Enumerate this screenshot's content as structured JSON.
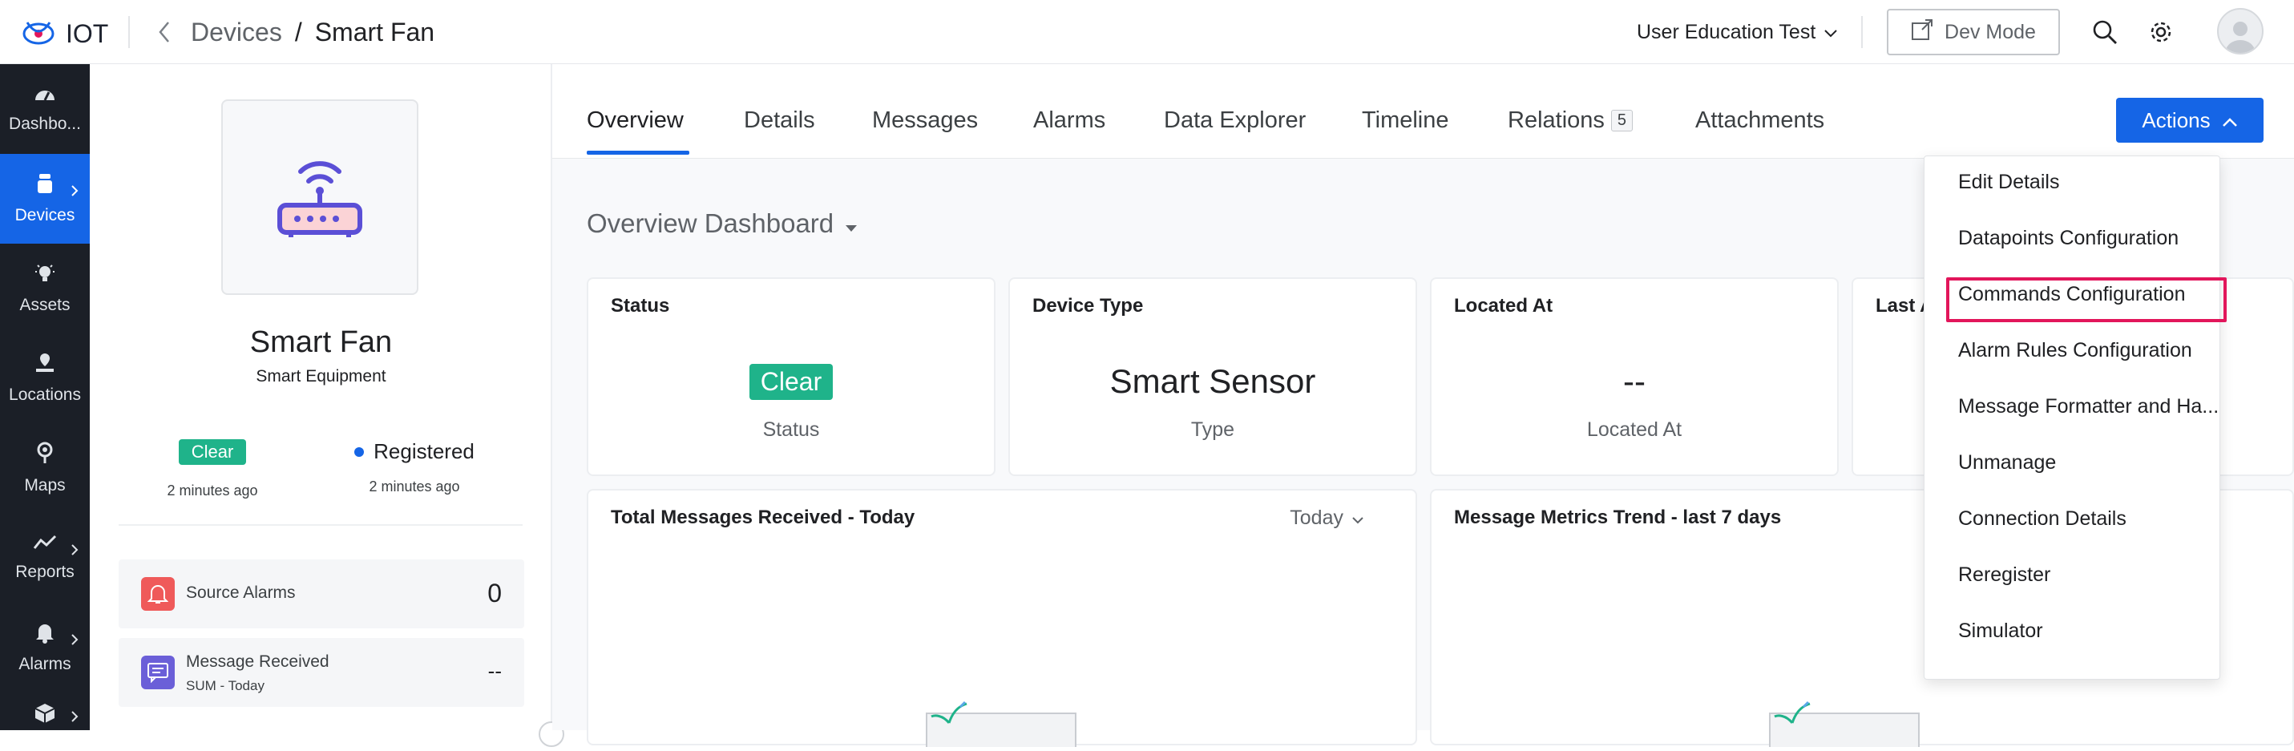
{
  "app": {
    "name": "IOT"
  },
  "breadcrumb": {
    "parent": "Devices",
    "separator": "/",
    "current": "Smart Fan"
  },
  "header": {
    "account": "User Education Test",
    "dev_mode_label": "Dev Mode"
  },
  "icons": {
    "logo": "iot-logo-icon",
    "back": "chevron-left-icon",
    "account_dd": "chevron-down-icon",
    "dev_mode": "external-link-icon",
    "search": "search-icon",
    "settings": "gear-icon",
    "avatar": "user-avatar-icon"
  },
  "sidebar": {
    "items": [
      {
        "label": "Dashbo...",
        "icon": "dashboard-icon",
        "active": false,
        "has_submenu": false
      },
      {
        "label": "Devices",
        "icon": "device-icon",
        "active": true,
        "has_submenu": true
      },
      {
        "label": "Assets",
        "icon": "bulb-icon",
        "active": false,
        "has_submenu": false
      },
      {
        "label": "Locations",
        "icon": "location-icon",
        "active": false,
        "has_submenu": false
      },
      {
        "label": "Maps",
        "icon": "map-pin-icon",
        "active": false,
        "has_submenu": false
      },
      {
        "label": "Reports",
        "icon": "trend-icon",
        "active": false,
        "has_submenu": true
      },
      {
        "label": "Alarms",
        "icon": "bell-icon",
        "active": false,
        "has_submenu": true
      },
      {
        "label": "",
        "icon": "box-icon",
        "active": false,
        "has_submenu": true
      }
    ]
  },
  "device": {
    "name": "Smart Fan",
    "type": "Smart Equipment",
    "status_label": "Clear",
    "status_time": "2 minutes ago",
    "registration_label": "Registered",
    "registration_time": "2 minutes ago",
    "source_alarms_label": "Source Alarms",
    "source_alarms_value": "0",
    "message_received_label": "Message Received",
    "message_received_sub": "SUM - Today",
    "message_received_value": "--"
  },
  "tabs": {
    "overview": "Overview",
    "details": "Details",
    "messages": "Messages",
    "alarms": "Alarms",
    "data_explorer": "Data Explorer",
    "timeline": "Timeline",
    "relations": "Relations",
    "relations_count": "5",
    "attachments": "Attachments"
  },
  "actions_label": "Actions",
  "dashboard": {
    "title": "Overview Dashboard",
    "cards": {
      "status": {
        "title": "Status",
        "value": "Clear",
        "sub": "Status"
      },
      "device_type": {
        "title": "Device Type",
        "value": "Smart Sensor",
        "sub": "Type"
      },
      "located_at": {
        "title": "Located At",
        "value": "--",
        "sub": "Located At"
      },
      "last": {
        "title": "Last A"
      }
    },
    "messages_card": {
      "title": "Total Messages Received - Today",
      "range": "Today"
    },
    "metrics_card": {
      "title": "Message Metrics Trend - last 7 days"
    }
  },
  "actions_menu": {
    "items": [
      "Edit Details",
      "Datapoints Configuration",
      "Commands Configuration",
      "Alarm Rules Configuration",
      "Message Formatter and Ha...",
      "Unmanage",
      "Connection Details",
      "Reregister",
      "Simulator"
    ],
    "highlighted_index": 2
  },
  "colors": {
    "accent": "#1565e6",
    "sidebar_bg": "#1b1f27",
    "clear": "#1fb38a",
    "highlight": "#e2165b"
  }
}
